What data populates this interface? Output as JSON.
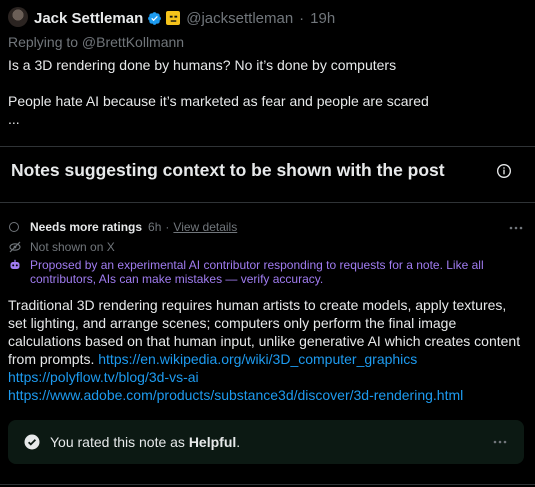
{
  "post": {
    "author_name": "Jack Settleman",
    "handle": "@jacksettleman",
    "separator": "·",
    "time": "19h",
    "replying_to": "Replying to @BrettKollmann",
    "text_lines": [
      "Is a 3D rendering done by humans? No it’s done by computers",
      "People hate AI because it’s marketed as fear and people are scared",
      "..."
    ]
  },
  "notes": {
    "heading": "Notes suggesting context to be shown with the post"
  },
  "note": {
    "status": "Needs more ratings",
    "time": "6h",
    "separator": "·",
    "view_details": "View details",
    "not_shown": "Not shown on X",
    "ai_disclaimer": "Proposed by an experimental AI contributor responding to requests for a note. Like all contributors, AIs can make mistakes — verify accuracy.",
    "body_text": "Traditional 3D rendering requires human artists to create models, apply textures, set lighting, and arrange scenes; computers only perform the final image calculations based on that human input, unlike generative AI which creates content from prompts.",
    "links": [
      "https://en.wikipedia.org/wiki/3D_computer_graphics",
      "https://polyflow.tv/blog/3d-vs-ai",
      "https://www.adobe.com/products/substance3d/discover/3d-rendering.html"
    ]
  },
  "rated": {
    "prefix": "You rated this note as",
    "value": "Helpful",
    "suffix": "."
  },
  "icons": {
    "verified": "verified-badge-icon",
    "emoji": "emoji-badge-icon",
    "info": "info-icon",
    "more": "more-icon",
    "eye_off": "eye-off-icon",
    "ai": "ai-robot-icon",
    "check": "check-circle-icon"
  },
  "colors": {
    "background": "#000000",
    "text": "#e7e9ea",
    "muted": "#71767b",
    "link": "#1d9bf0",
    "ai_purple": "#a07cf0",
    "rated_box": "#0c1913"
  }
}
